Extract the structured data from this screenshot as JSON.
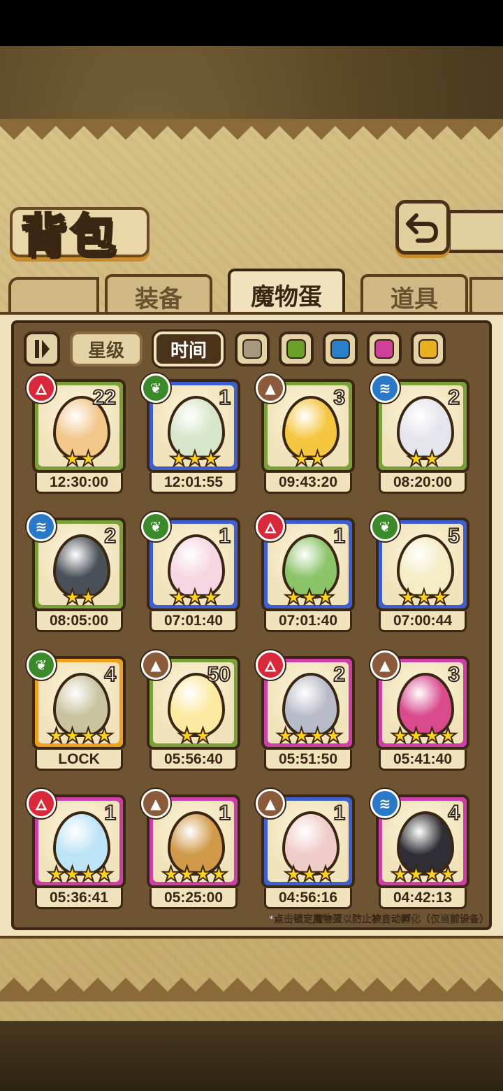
{
  "title": "背包",
  "tabs": [
    {
      "label": "装备",
      "active": false
    },
    {
      "label": "魔物蛋",
      "active": true
    },
    {
      "label": "道具",
      "active": false
    }
  ],
  "sort": {
    "star_label": "星级",
    "time_label": "时间",
    "active": "时间"
  },
  "color_filters": [
    "#a89a80",
    "#6aa02a",
    "#2a80c8",
    "#d0409a",
    "#e8b020"
  ],
  "eggs": [
    {
      "element": "fire",
      "count": "22",
      "stars": 2,
      "timer": "12:30:00",
      "border": "green",
      "color": "#f3c68a"
    },
    {
      "element": "leaf",
      "count": "1",
      "stars": 3,
      "timer": "12:01:55",
      "border": "blue",
      "color": "#d6e6c8"
    },
    {
      "element": "earth",
      "count": "3",
      "stars": 2,
      "timer": "09:43:20",
      "border": "green",
      "color": "#f5c640"
    },
    {
      "element": "water",
      "count": "2",
      "stars": 2,
      "timer": "08:20:00",
      "border": "green",
      "color": "#e4e4ec"
    },
    {
      "element": "water",
      "count": "2",
      "stars": 2,
      "timer": "08:05:00",
      "border": "green",
      "color": "#4a5058"
    },
    {
      "element": "leaf",
      "count": "1",
      "stars": 3,
      "timer": "07:01:40",
      "border": "blue",
      "color": "#f6d6e2"
    },
    {
      "element": "fire",
      "count": "1",
      "stars": 3,
      "timer": "07:01:40",
      "border": "blue",
      "color": "#8cc46a"
    },
    {
      "element": "leaf",
      "count": "5",
      "stars": 3,
      "timer": "07:00:44",
      "border": "blue",
      "color": "#f3ecc4"
    },
    {
      "element": "leaf",
      "count": "4",
      "stars": 4,
      "timer": "LOCK",
      "border": "orange",
      "color": "#c8c4a0"
    },
    {
      "element": "earth",
      "count": "50",
      "stars": 2,
      "timer": "05:56:40",
      "border": "green",
      "color": "#fbeaa0"
    },
    {
      "element": "fire",
      "count": "2",
      "stars": 4,
      "timer": "05:51:50",
      "border": "pink",
      "color": "#b8bcc8"
    },
    {
      "element": "earth",
      "count": "3",
      "stars": 4,
      "timer": "05:41:40",
      "border": "pink",
      "color": "#d84a8c"
    },
    {
      "element": "fire",
      "count": "1",
      "stars": 4,
      "timer": "05:36:41",
      "border": "pink",
      "color": "#bde4f6"
    },
    {
      "element": "earth",
      "count": "1",
      "stars": 4,
      "timer": "05:25:00",
      "border": "pink",
      "color": "#d09a4a"
    },
    {
      "element": "earth",
      "count": "1",
      "stars": 3,
      "timer": "04:56:16",
      "border": "blue",
      "color": "#f0ccc8"
    },
    {
      "element": "water",
      "count": "4",
      "stars": 4,
      "timer": "04:42:13",
      "border": "pink",
      "color": "#2e2e34"
    }
  ],
  "element_colors": {
    "fire": "#d8283a",
    "leaf": "#3a8a2a",
    "earth": "#8a5a3a",
    "water": "#2a78c8"
  },
  "element_icons": {
    "fire": "🜂",
    "leaf": "❦",
    "earth": "▲",
    "water": "≋"
  },
  "footnote": "*点击锁定魔物蛋以防止被自动孵化（仅当前设备）"
}
